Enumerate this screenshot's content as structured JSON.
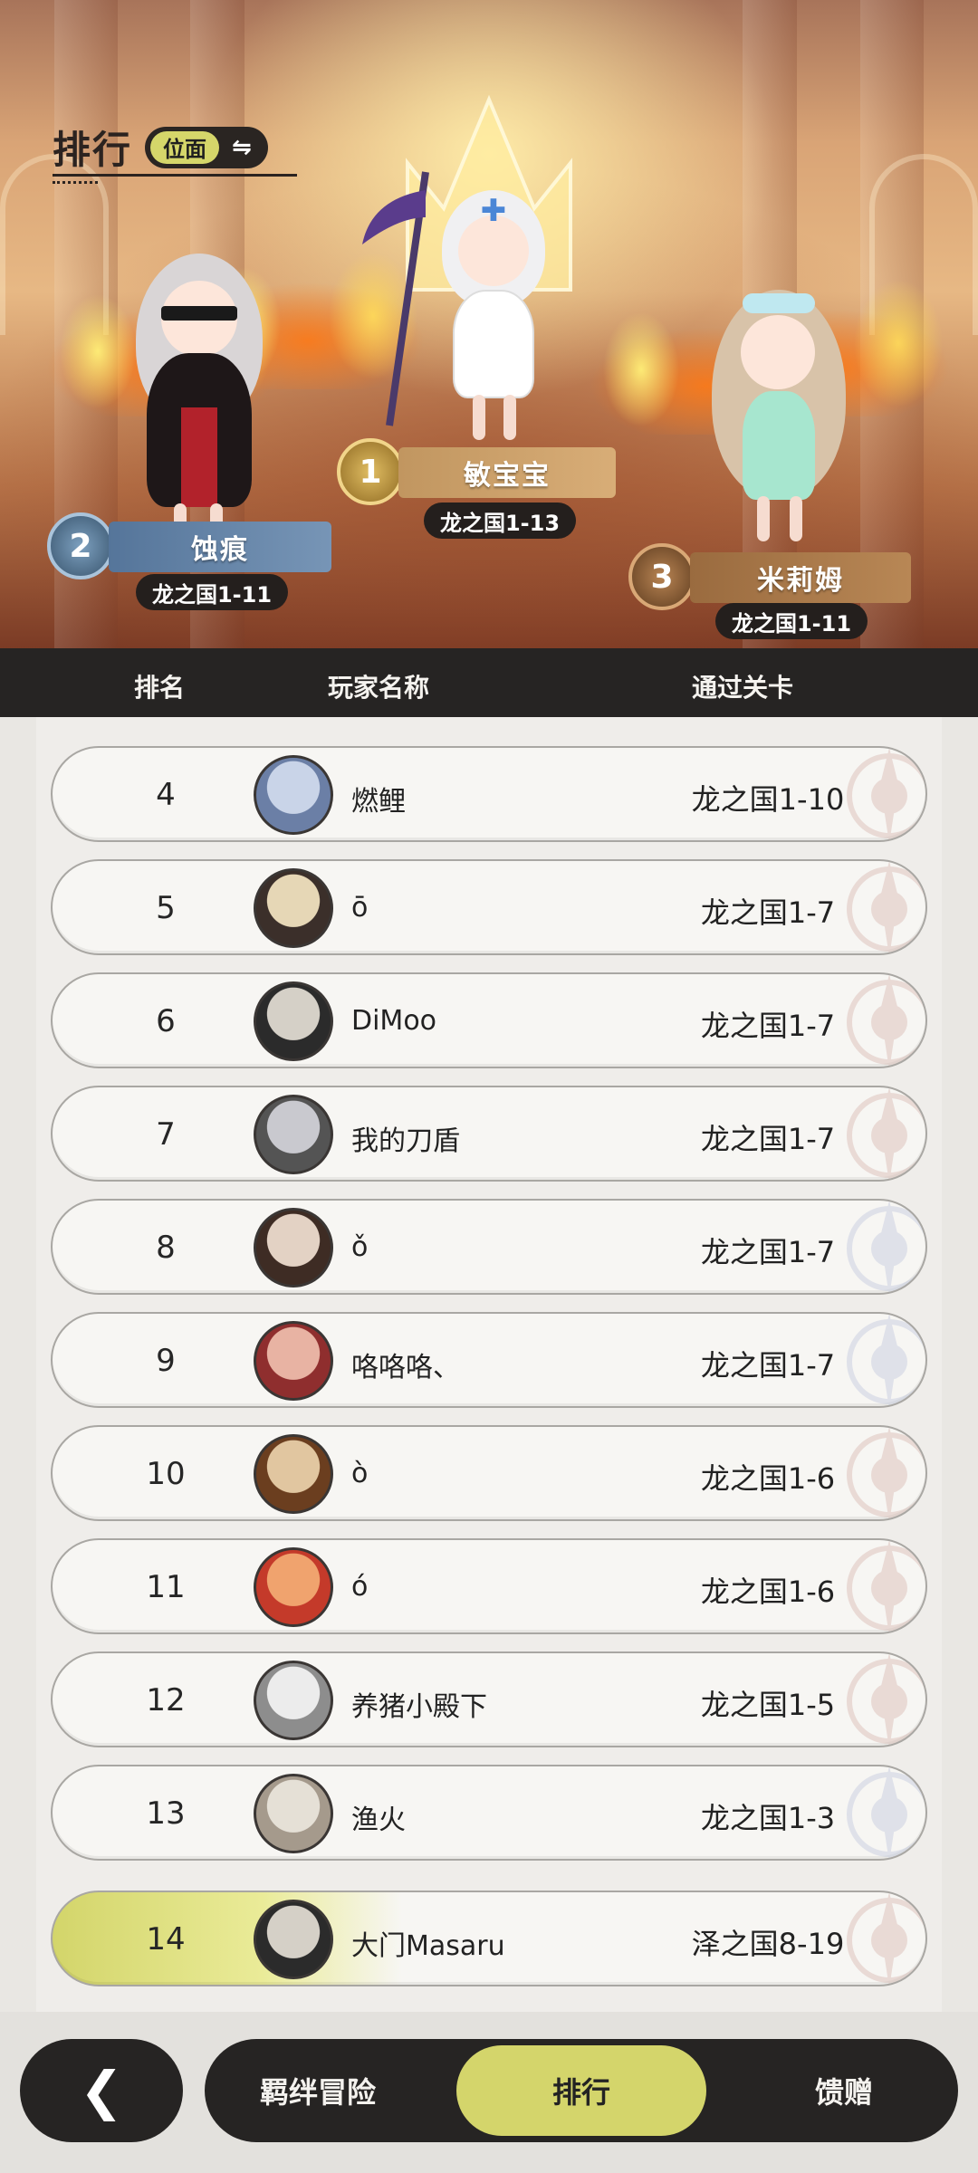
{
  "header": {
    "title": "排行",
    "mode_label": "位面",
    "swap_icon": "⇋"
  },
  "podium": [
    {
      "rank": "1",
      "name": "敏宝宝",
      "stage": "龙之国1-13",
      "medal_color": "#c9a04a"
    },
    {
      "rank": "2",
      "name": "蚀痕",
      "stage": "龙之国1-11",
      "medal_color": "#5f7e9b"
    },
    {
      "rank": "3",
      "name": "米莉姆",
      "stage": "龙之国1-11",
      "medal_color": "#9b6a3f"
    }
  ],
  "table": {
    "columns": [
      "排名",
      "玩家名称",
      "通过关卡"
    ],
    "rows": [
      {
        "rank": "4",
        "name": "燃鲤",
        "stage": "龙之国1-10"
      },
      {
        "rank": "5",
        "name": "ō",
        "stage": "龙之国1-7"
      },
      {
        "rank": "6",
        "name": "DiMoo",
        "stage": "龙之国1-7"
      },
      {
        "rank": "7",
        "name": "我的刀盾",
        "stage": "龙之国1-7"
      },
      {
        "rank": "8",
        "name": "ǒ",
        "stage": "龙之国1-7"
      },
      {
        "rank": "9",
        "name": "咯咯咯、",
        "stage": "龙之国1-7"
      },
      {
        "rank": "10",
        "name": "ò",
        "stage": "龙之国1-6"
      },
      {
        "rank": "11",
        "name": "ó",
        "stage": "龙之国1-6"
      },
      {
        "rank": "12",
        "name": "养猪小殿下",
        "stage": "龙之国1-5"
      },
      {
        "rank": "13",
        "name": "渔火",
        "stage": "龙之国1-3"
      }
    ],
    "self_row": {
      "rank": "14",
      "name": "大门Masaru",
      "stage": "泽之国8-19"
    }
  },
  "bottom_nav": {
    "back_icon": "chevron-left-icon",
    "back_glyph": "❮",
    "tabs": [
      "羁绊冒险",
      "排行",
      "馈赠"
    ],
    "active_tab": "排行"
  },
  "colors": {
    "accent": "#d4d56b",
    "dark": "#262423"
  }
}
